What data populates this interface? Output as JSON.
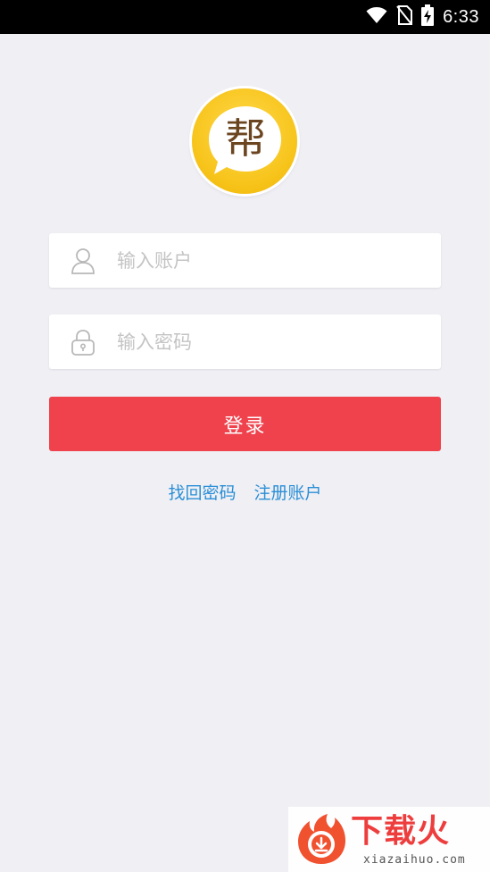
{
  "status_bar": {
    "time": "6:33",
    "icons": [
      "wifi-icon",
      "no-sim-icon",
      "battery-charging-icon"
    ]
  },
  "logo": {
    "character": "帮",
    "colors": {
      "outer": "#f7c41b",
      "bubble": "#ffffff",
      "character": "#6b4520"
    }
  },
  "login_form": {
    "account": {
      "placeholder": "输入账户",
      "value": "",
      "icon": "user-icon"
    },
    "password": {
      "placeholder": "输入密码",
      "value": "",
      "icon": "lock-icon"
    },
    "submit_label": "登录"
  },
  "links": {
    "find_password": "找回密码",
    "register": "注册账户"
  },
  "watermark": {
    "title": "下载火",
    "url": "xiazaihuo.com"
  },
  "colors": {
    "background": "#efeff4",
    "button": "#ef424d",
    "link": "#2b8fd6",
    "placeholder": "#c4c4c4"
  }
}
